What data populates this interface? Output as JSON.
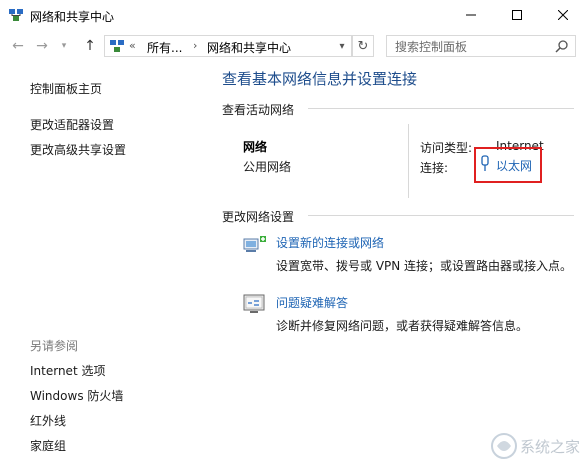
{
  "window": {
    "title": "网络和共享中心",
    "controls": {
      "minimize": "—",
      "maximize": "☐",
      "close": "✕"
    }
  },
  "address": {
    "overflow": "«",
    "segments": [
      "所有...",
      "网络和共享中心"
    ],
    "separator": "›"
  },
  "search": {
    "placeholder": "搜索控制面板"
  },
  "sidebar": {
    "links": [
      "控制面板主页",
      "更改适配器设置",
      "更改高级共享设置"
    ],
    "see_also_heading": "另请参阅",
    "see_also": [
      "Internet 选项",
      "Windows 防火墙",
      "红外线",
      "家庭组"
    ]
  },
  "main": {
    "title": "查看基本网络信息并设置连接",
    "active_networks_heading": "查看活动网络",
    "network": {
      "name": "网络",
      "category": "公用网络",
      "access_type_label": "访问类型:",
      "access_type_value": "Internet",
      "connections_label": "连接:",
      "connections_value": "以太网"
    },
    "change_settings_heading": "更改网络设置",
    "tasks": [
      {
        "link": "设置新的连接或网络",
        "desc": "设置宽带、拨号或 VPN 连接；或设置路由器或接入点。"
      },
      {
        "link": "问题疑难解答",
        "desc": "诊断并修复网络问题，或者获得疑难解答信息。"
      }
    ]
  },
  "watermark": {
    "text": "系统之家"
  },
  "colors": {
    "link": "#1e64b4",
    "title": "#1e4d8c",
    "highlight": "#e02020"
  }
}
